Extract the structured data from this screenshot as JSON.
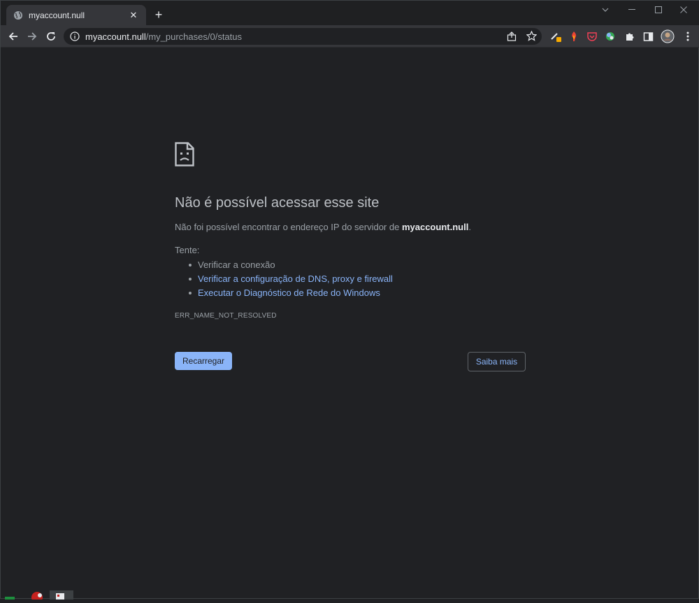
{
  "browser": {
    "tab": {
      "title": "myaccount.null",
      "favicon": "globe-icon"
    },
    "omnibox": {
      "host": "myaccount.null",
      "path": "/my_purchases/0/status"
    },
    "extensions": [
      "pen-icon",
      "flame-icon",
      "pocket-icon",
      "colorful-circle-icon",
      "puzzle-icon",
      "sidepanel-icon",
      "avatar",
      "kebab-menu-icon"
    ]
  },
  "error_page": {
    "title": "Não é possível acessar esse site",
    "desc_prefix": "Não foi possível encontrar o endereço IP do servidor de ",
    "desc_host": "myaccount.null",
    "desc_suffix": ".",
    "try_label": "Tente:",
    "suggestions": [
      "Verificar a conexão",
      "Verificar a configuração de DNS, proxy e firewall",
      "Executar o Diagnóstico de Rede do Windows"
    ],
    "error_code": "ERR_NAME_NOT_RESOLVED",
    "reload_label": "Recarregar",
    "learn_more_label": "Saiba mais"
  },
  "colors": {
    "background": "#202124",
    "link": "#8ab4f8",
    "title": "#bdc1c6",
    "text": "#9aa0a6"
  }
}
